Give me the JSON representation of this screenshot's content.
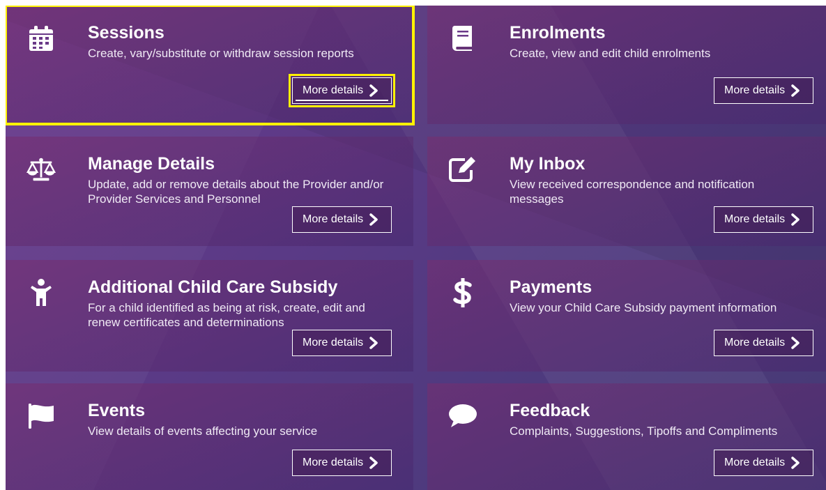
{
  "tiles": [
    {
      "key": "sessions",
      "title": "Sessions",
      "description": "Create, vary/substitute or withdraw session reports",
      "button": "More details",
      "icon": "calendar-icon"
    },
    {
      "key": "enrolments",
      "title": "Enrolments",
      "description": "Create, view and edit child enrolments",
      "button": "More details",
      "icon": "book-icon"
    },
    {
      "key": "manage-details",
      "title": "Manage Details",
      "description": "Update, add or remove details about the Provider and/or Provider Services and Personnel",
      "button": "More details",
      "icon": "scales-icon"
    },
    {
      "key": "my-inbox",
      "title": "My Inbox",
      "description": "View received correspondence and notification messages",
      "button": "More details",
      "icon": "edit-icon"
    },
    {
      "key": "additional-child-care-subsidy",
      "title": "Additional Child Care Subsidy",
      "description": "For a child identified as being at risk, create, edit and renew certificates and determinations",
      "button": "More details",
      "icon": "child-icon"
    },
    {
      "key": "payments",
      "title": "Payments",
      "description": "View your Child Care Subsidy payment information",
      "button": "More details",
      "icon": "dollar-icon"
    },
    {
      "key": "events",
      "title": "Events",
      "description": "View details of events affecting your service",
      "button": "More details",
      "icon": "flag-icon"
    },
    {
      "key": "feedback",
      "title": "Feedback",
      "description": "Complaints, Suggestions, Tipoffs and Compliments",
      "button": "More details",
      "icon": "speech-bubble-icon"
    }
  ],
  "colors": {
    "focus": "#fff200",
    "text": "#ffffff",
    "background": "#5a3a86"
  }
}
